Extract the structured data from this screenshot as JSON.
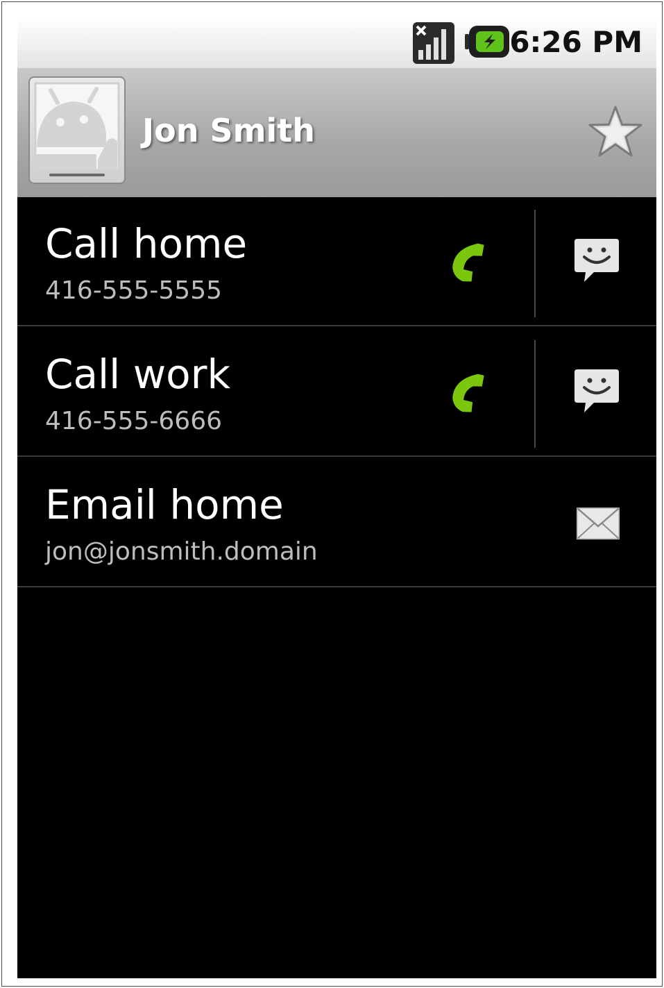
{
  "status_bar": {
    "time": "6:26 PM",
    "signal_icon": "signal-no-service-icon",
    "battery_icon": "battery-charging-icon"
  },
  "contact": {
    "name": "Jon Smith",
    "avatar_icon": "android-avatar-icon",
    "favorite_icon": "star-outline-icon"
  },
  "actions": [
    {
      "title": "Call home",
      "subtitle": "416-555-5555",
      "primary_icon": "phone-icon",
      "secondary_icon": "sms-icon"
    },
    {
      "title": "Call work",
      "subtitle": "416-555-6666",
      "primary_icon": "phone-icon",
      "secondary_icon": "sms-icon"
    },
    {
      "title": "Email home",
      "subtitle": "jon@jonsmith.domain",
      "primary_icon": "email-icon"
    }
  ],
  "colors": {
    "phone_green": "#7ac70e",
    "header_gray": "#a9a9a9",
    "background": "#000000"
  }
}
